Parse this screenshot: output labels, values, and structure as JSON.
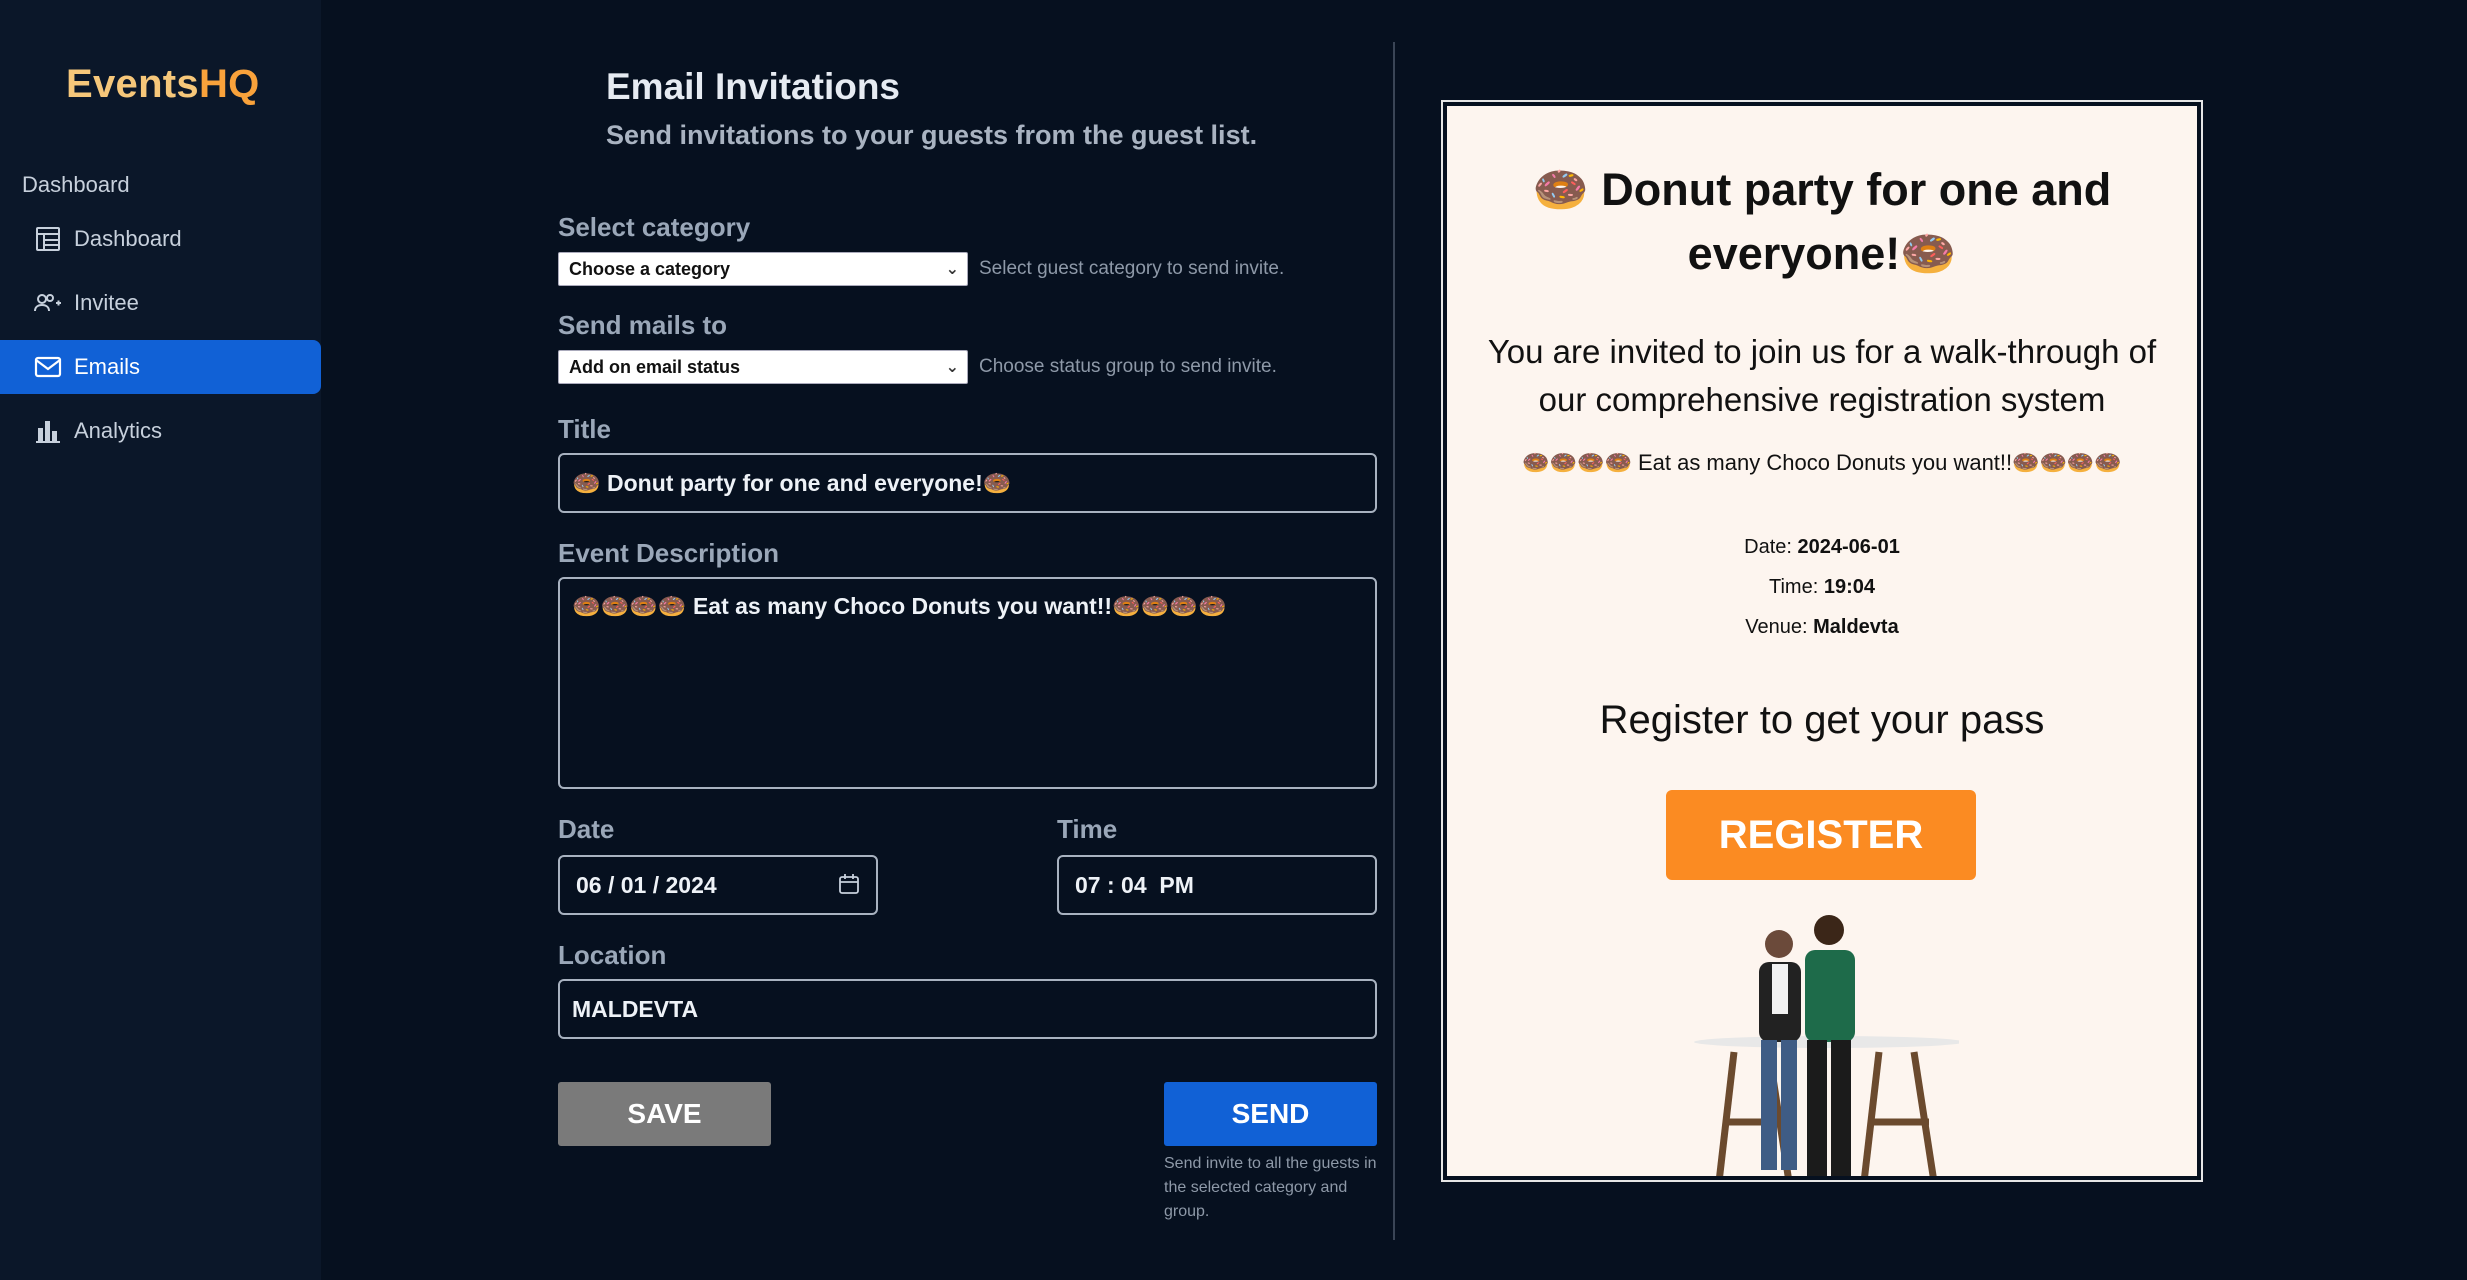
{
  "brand": {
    "part1": "Events",
    "part2": "HQ"
  },
  "sidebar": {
    "section_label": "Dashboard",
    "items": [
      {
        "label": "Dashboard",
        "icon": "table-icon",
        "active": false
      },
      {
        "label": "Invitee",
        "icon": "add-user-icon",
        "active": false
      },
      {
        "label": "Emails",
        "icon": "mail-icon",
        "active": true
      },
      {
        "label": "Analytics",
        "icon": "bar-chart-icon",
        "active": false
      }
    ]
  },
  "header": {
    "title": "Email Invitations",
    "subtitle": "Send invitations to your guests from the guest list."
  },
  "form": {
    "category": {
      "label": "Select category",
      "value": "Choose a category",
      "hint": "Select guest category to send invite."
    },
    "mails_to": {
      "label": "Send mails to",
      "value": "Add on email status",
      "hint": "Choose status group to send invite."
    },
    "title": {
      "label": "Title",
      "value": "🍩 Donut party for one and everyone!🍩"
    },
    "description": {
      "label": "Event Description",
      "value": "🍩🍩🍩🍩 Eat as many Choco Donuts you want!!🍩🍩🍩🍩"
    },
    "date": {
      "label": "Date",
      "value": "06 / 01 / 2024"
    },
    "time": {
      "label": "Time",
      "value": "07 : 04  PM"
    },
    "location": {
      "label": "Location",
      "value": "MALDEVTA"
    },
    "save_label": "SAVE",
    "send_label": "SEND",
    "send_hint": "Send invite to all the guests in the selected category and group."
  },
  "preview": {
    "title": "🍩 Donut party for one and everyone!🍩",
    "intro": "You are invited to join us for a walk-through of our comprehensive registration system",
    "description": "🍩🍩🍩🍩 Eat as many Choco Donuts you want!!🍩🍩🍩🍩",
    "date_label": "Date: ",
    "date_value": "2024-06-01",
    "time_label": "Time: ",
    "time_value": "19:04",
    "venue_label": "Venue: ",
    "venue_value": "Maldevta",
    "register_text": "Register to get your pass",
    "register_button": "REGISTER"
  },
  "colors": {
    "background": "#06101f",
    "sidebar": "#0b1729",
    "accent": "#1161d6",
    "brand_orange": "#f9a23b",
    "register_orange": "#fb8b22",
    "preview_bg": "#fdf5ef"
  }
}
